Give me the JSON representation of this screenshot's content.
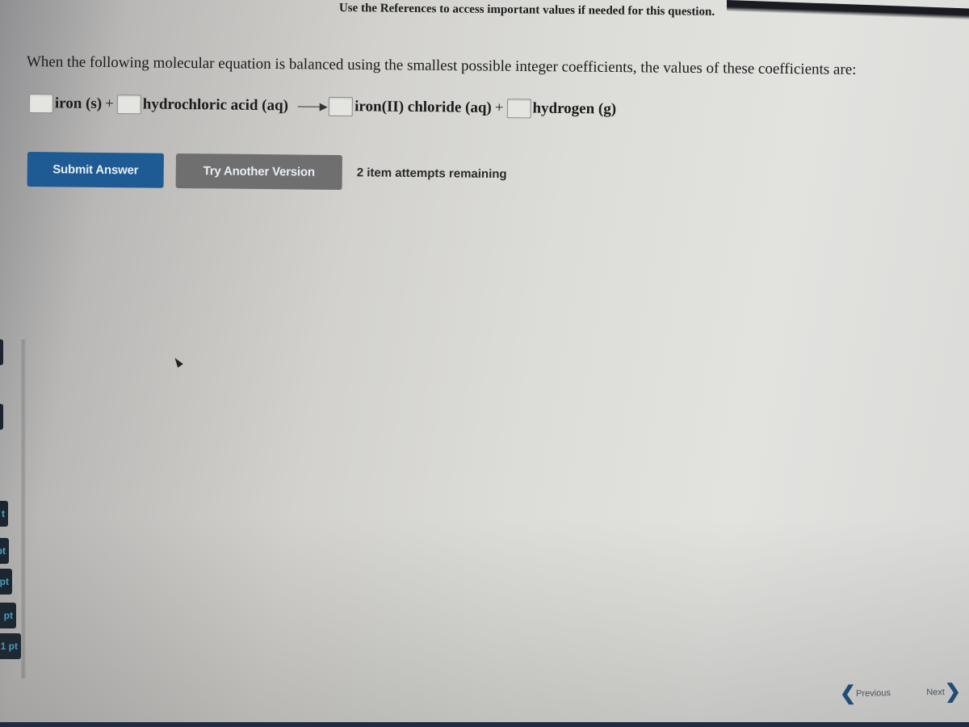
{
  "header": {
    "references_note": "Use the References to access important values if needed for this question."
  },
  "question": {
    "prompt": "When the following molecular equation is balanced using the smallest possible integer coefficients, the values of these coefficients are:"
  },
  "equation": {
    "reactants": [
      {
        "species": "iron (s)",
        "coefficient": ""
      },
      {
        "species": "hydrochloric acid (aq)",
        "coefficient": ""
      }
    ],
    "products": [
      {
        "species": "iron(II) chloride (aq)",
        "coefficient": ""
      },
      {
        "species": "hydrogen (g)",
        "coefficient": ""
      }
    ],
    "plus": "+",
    "arrow_icon": "right-arrow"
  },
  "actions": {
    "submit_label": "Submit Answer",
    "try_another_label": "Try Another Version",
    "attempts_text": "2 item attempts remaining"
  },
  "sidebar": {
    "items": [
      {
        "label": ""
      },
      {
        "label": ""
      },
      {
        "label": "t"
      },
      {
        "label": "pt"
      },
      {
        "label": "pt"
      },
      {
        "label": "pt"
      },
      {
        "label": "1 pt"
      }
    ]
  },
  "navigation": {
    "previous_label": "Previous",
    "next_label": "Next",
    "previous_icon": "chevron-left",
    "next_icon": "chevron-right"
  },
  "colors": {
    "submit_button": "#1e5a93",
    "try_another_button": "#6f6f70",
    "nav_chevron": "#1e4f80"
  }
}
